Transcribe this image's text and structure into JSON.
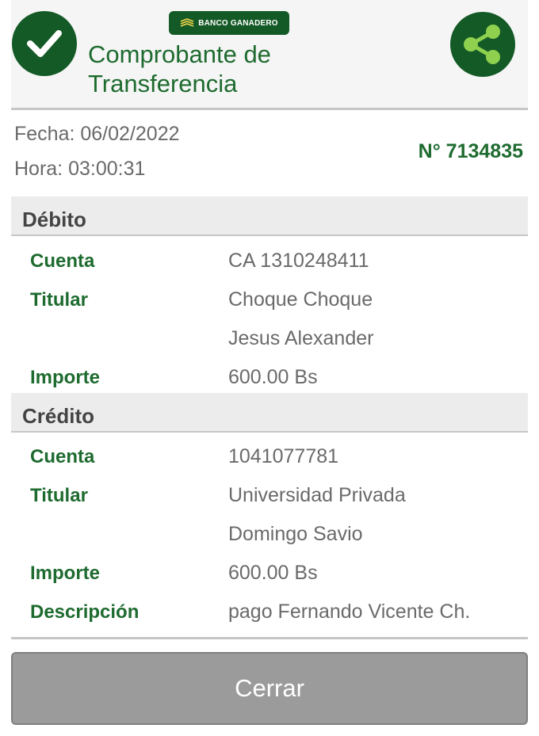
{
  "header": {
    "bank_logo": "BANCO GANADERO",
    "title": "Comprobante de Transferencia",
    "icons": {
      "status": "check-icon",
      "share": "share-icon"
    }
  },
  "meta": {
    "fecha": "Fecha: 06/02/2022",
    "hora": "Hora: 03:00:31",
    "numero": "N° 7134835"
  },
  "debito": {
    "title": "Débito",
    "cuenta_label": "Cuenta",
    "cuenta_value": "CA 1310248411",
    "titular_label": "Titular",
    "titular_line1": "Choque Choque",
    "titular_line2": "Jesus Alexander",
    "importe_label": "Importe",
    "importe_value": "600.00 Bs"
  },
  "credito": {
    "title": "Crédito",
    "cuenta_label": "Cuenta",
    "cuenta_value": "1041077781",
    "titular_label": "Titular",
    "titular_line1": "Universidad Privada",
    "titular_line2": "Domingo Savio",
    "importe_label": "Importe",
    "importe_value": "600.00 Bs",
    "descripcion_label": "Descripción",
    "descripcion_value": "pago Fernando Vicente Ch."
  },
  "actions": {
    "close_label": "Cerrar"
  },
  "colors": {
    "brand_green": "#145a26",
    "label_green": "#1e6b2f",
    "share_accent": "#8fd14f",
    "button_gray": "#9b9b9b"
  }
}
